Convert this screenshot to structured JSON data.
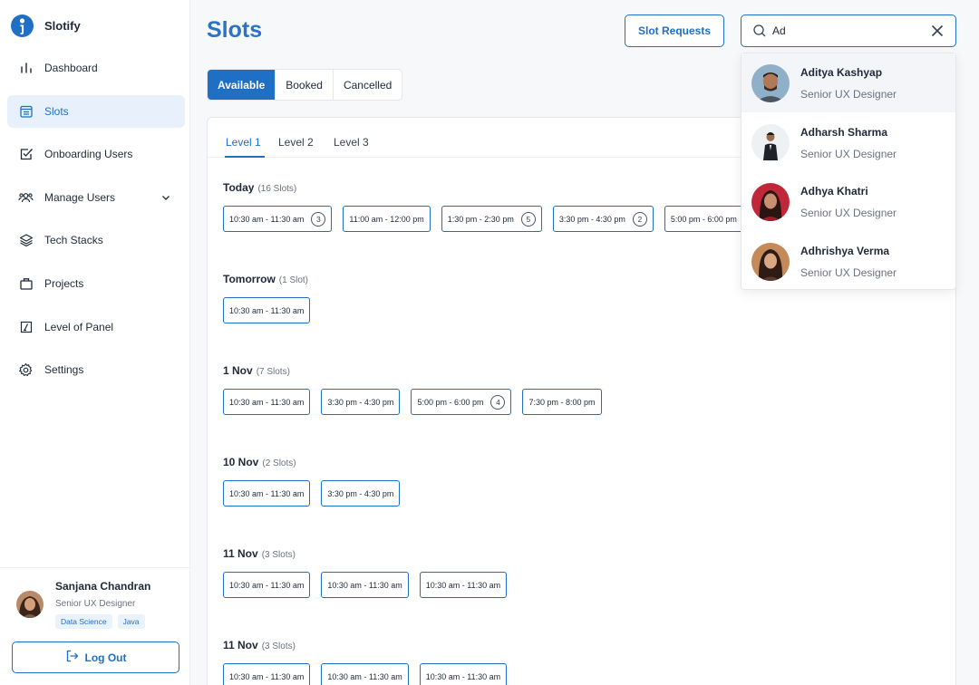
{
  "app": {
    "name": "Slotify"
  },
  "sidebar": {
    "items": [
      {
        "label": "Dashboard",
        "icon": "bar-chart-icon"
      },
      {
        "label": "Slots",
        "icon": "calendar-list-icon",
        "active": true
      },
      {
        "label": "Onboarding Users",
        "icon": "checkbox-icon"
      },
      {
        "label": "Manage Users",
        "icon": "users-icon",
        "expandable": true
      },
      {
        "label": "Tech Stacks",
        "icon": "layers-icon"
      },
      {
        "label": "Projects",
        "icon": "briefcase-icon"
      },
      {
        "label": "Level of Panel",
        "icon": "level-box-icon"
      },
      {
        "label": "Settings",
        "icon": "gear-icon"
      }
    ],
    "profile": {
      "name": "Sanjana Chandran",
      "role": "Senior UX Designer",
      "tags": [
        "Data Science",
        "Java"
      ]
    },
    "logout_label": "Log Out"
  },
  "header": {
    "title": "Slots",
    "slot_requests_label": "Slot Requests",
    "search": {
      "value": "Ad",
      "placeholder": ""
    }
  },
  "status_tabs": [
    {
      "label": "Available",
      "active": true
    },
    {
      "label": "Booked"
    },
    {
      "label": "Cancelled"
    }
  ],
  "level_tabs": [
    {
      "label": "Level 1",
      "active": true
    },
    {
      "label": "Level 2"
    },
    {
      "label": "Level 3"
    }
  ],
  "days": [
    {
      "label": "Today",
      "count": "(16 Slots)",
      "slots": [
        {
          "time": "10:30 am - 11:30 am",
          "badge": "3"
        },
        {
          "time": "11:00 am - 12:00 pm"
        },
        {
          "time": "1:30 pm - 2:30 pm",
          "badge": "5"
        },
        {
          "time": "3:30 pm - 4:30 pm",
          "badge": "2"
        },
        {
          "time": "5:00 pm - 6:00 pm"
        }
      ]
    },
    {
      "label": "Tomorrow",
      "count": "(1 Slot)",
      "slots": [
        {
          "time": "10:30 am - 11:30 am"
        }
      ]
    },
    {
      "label": "1 Nov",
      "count": "(7 Slots)",
      "slots": [
        {
          "time": "10:30 am - 11:30 am"
        },
        {
          "time": "3:30 pm - 4:30 pm"
        },
        {
          "time": "5:00 pm - 6:00 pm",
          "badge": "4"
        },
        {
          "time": "7:30 pm - 8:00 pm"
        }
      ]
    },
    {
      "label": "10 Nov",
      "count": "(2 Slots)",
      "slots": [
        {
          "time": "10:30 am - 11:30 am"
        },
        {
          "time": "3:30 pm - 4:30 pm"
        }
      ]
    },
    {
      "label": "11 Nov",
      "count": "(3 Slots)",
      "slots": [
        {
          "time": "10:30 am - 11:30 am"
        },
        {
          "time": "10:30 am - 11:30 am"
        },
        {
          "time": "10:30 am - 11:30 am"
        }
      ]
    },
    {
      "label": "11 Nov",
      "count": "(3 Slots)",
      "slots": [
        {
          "time": "10:30 am - 11:30 am"
        },
        {
          "time": "10:30 am - 11:30 am"
        },
        {
          "time": "10:30 am - 11:30 am"
        }
      ]
    }
  ],
  "search_results": [
    {
      "name": "Aditya Kashyap",
      "role": "Senior UX Designer",
      "highlighted": true
    },
    {
      "name": "Adharsh Sharma",
      "role": "Senior UX Designer"
    },
    {
      "name": "Adhya Khatri",
      "role": "Senior UX Designer"
    },
    {
      "name": "Adhrishya Verma",
      "role": "Senior UX Designer"
    }
  ],
  "colors": {
    "primary": "#1f6fc5",
    "title": "#2b74c5",
    "active_nav_bg": "#e8f1fb"
  }
}
